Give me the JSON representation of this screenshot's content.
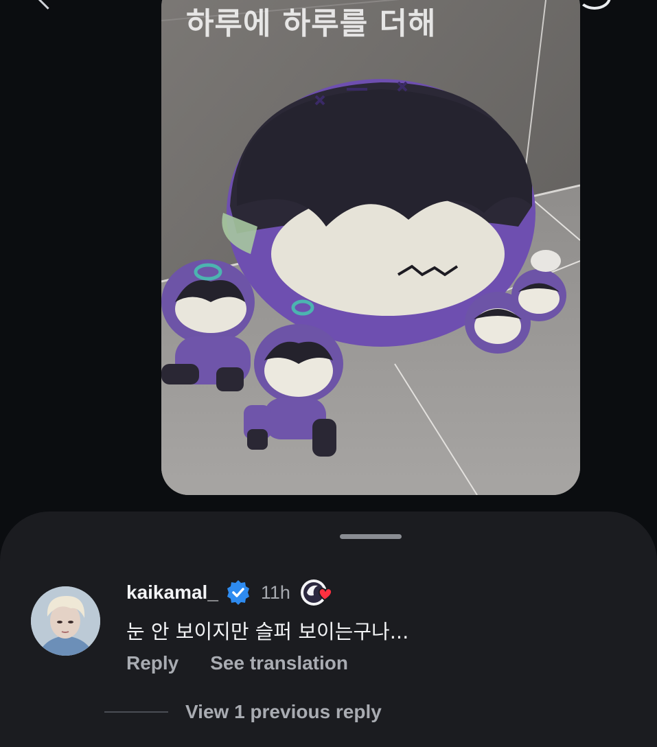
{
  "story": {
    "caption": "하루에 하루를 더해"
  },
  "comment": {
    "username": "kaikamal_",
    "timestamp": "11h",
    "text": "눈 안 보이지만 슬퍼 보이는구나...",
    "actions": {
      "reply_label": "Reply",
      "translate_label": "See translation"
    },
    "view_replies_label": "View 1 previous reply"
  },
  "icons": {
    "verified": "verified-badge-icon",
    "liked_by_author": "liked-by-author-icon"
  },
  "colors": {
    "background": "#0b0d10",
    "sheet": "#1b1c20",
    "verified_blue": "#2e8bf0",
    "like_red": "#ff3040",
    "primary_text": "#f3f4f6",
    "secondary_text": "#a9acb2"
  }
}
